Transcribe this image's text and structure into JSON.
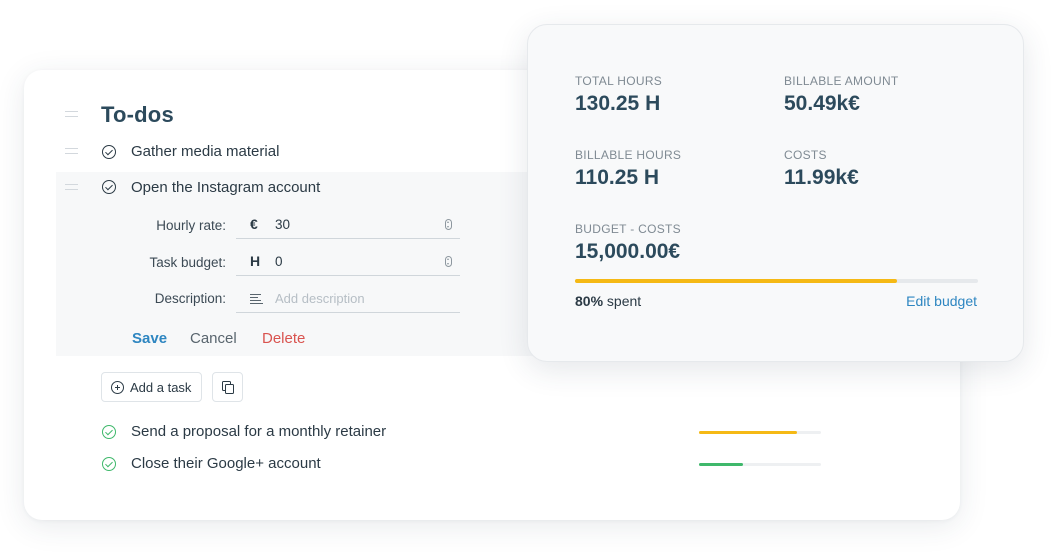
{
  "todos": {
    "title": "To-dos",
    "tasks": [
      {
        "label": "Gather media material",
        "status": "done"
      },
      {
        "label": "Open the Instagram account",
        "status": "done"
      }
    ],
    "edit_form": {
      "hourly_rate": {
        "label": "Hourly rate:",
        "prefix": "€",
        "value": "30"
      },
      "task_budget": {
        "label": "Task budget:",
        "prefix": "H",
        "value": "0"
      },
      "description": {
        "label": "Description:",
        "placeholder": "Add description"
      },
      "save_label": "Save",
      "cancel_label": "Cancel",
      "delete_label": "Delete"
    },
    "add_task_label": "Add a task",
    "completed_tasks": [
      {
        "label": "Send a proposal for a monthly retainer",
        "progress": 0.8,
        "color": "#f5b915"
      },
      {
        "label": "Close their Google+ account",
        "progress": 0.36,
        "color": "#3fb86b"
      }
    ]
  },
  "budget": {
    "total_hours_label": "TOTAL HOURS",
    "total_hours_value": "130.25 H",
    "billable_amount_label": "BILLABLE AMOUNT",
    "billable_amount_value": "50.49k€",
    "billable_hours_label": "BILLABLE HOURS",
    "billable_hours_value": "110.25 H",
    "costs_label": "COSTS",
    "costs_value": "11.99k€",
    "budget_costs_label": "BUDGET - COSTS",
    "budget_costs_value": "15,000.00€",
    "spent_percent": "80%",
    "spent_suffix": "spent",
    "spent_fraction": 0.8,
    "edit_budget_label": "Edit budget",
    "accent_color": "#f5b915"
  },
  "colors": {
    "heading": "#2c4a5c",
    "link": "#2e86c1",
    "danger": "#d9534f",
    "success": "#3fb86b"
  }
}
